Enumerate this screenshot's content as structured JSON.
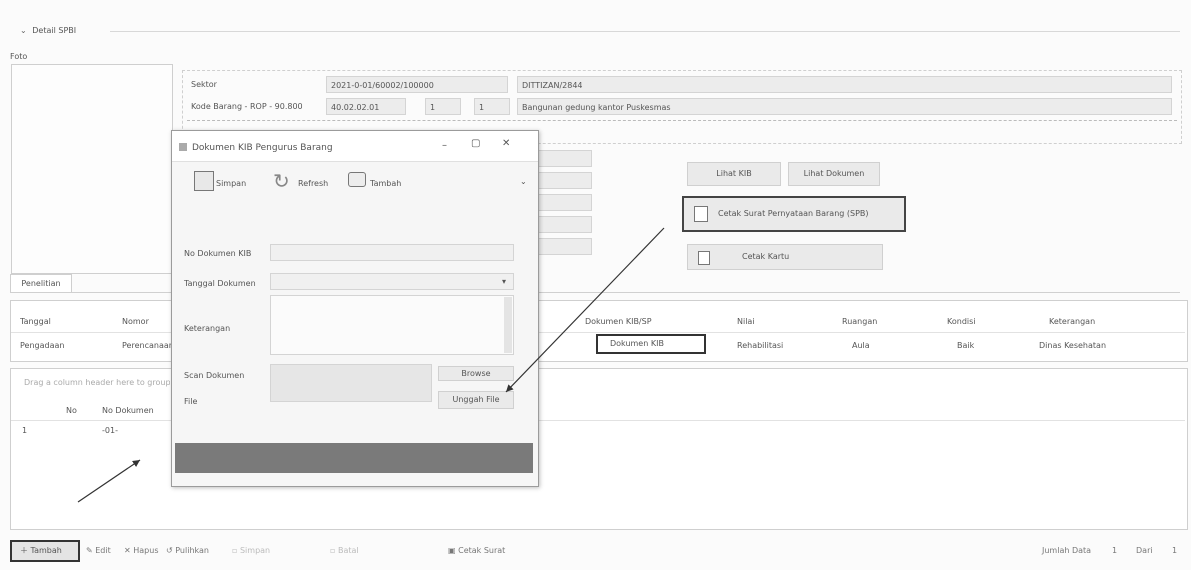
{
  "detail_header": {
    "toggle": "⌄",
    "title": "Detail SPBI",
    "foto_label": "Foto"
  },
  "main_fields": {
    "sektor_label": "Sektor",
    "sektor_code": "2021-0-01/60002/100000",
    "sektor_name": "DITTIZAN/2844",
    "kode_label": "Kode Barang - ROP - 90.800",
    "kode_value": "40.02.02.01",
    "kode_n1": "1",
    "kode_n2": "1",
    "kode_desc": "Bangunan gedung kantor Puskesmas"
  },
  "action_buttons": {
    "lihat_kib": "Lihat KIB",
    "lihat_dokumen": "Lihat Dokumen",
    "cetak_surat": "Cetak Surat Pernyataan Barang (SPB)",
    "cetak_kartu": "Cetak Kartu"
  },
  "tab_label": "Penelitian",
  "grid_headers": [
    "Tanggal",
    "Nomor",
    "Dokumen KIB/SP",
    "Nilai",
    "Ruangan",
    "Kondisi",
    "Keterangan"
  ],
  "grid_row": [
    "Pengadaan",
    "Perencanaan",
    "Dokumen KIB",
    "Rehabilitasi",
    "Aula",
    "Baik",
    "Dinas Kesehatan"
  ],
  "doc_grid": {
    "group_header": "Drag a column header here to group by that column",
    "col_no": "No",
    "col_nomor": "No Dokumen",
    "row_no": "1",
    "row_nomor": "-01-"
  },
  "dialog": {
    "title": "Dokumen KIB Pengurus Barang",
    "toolbar": {
      "simpan": "Simpan",
      "refresh": "Refresh",
      "tambah": "Tambah"
    },
    "labels": {
      "no_dokumen": "No Dokumen KIB",
      "tanggal": "Tanggal Dokumen",
      "keterangan": "Keterangan",
      "scan": "Scan Dokumen",
      "file": "File"
    },
    "tanggal_dropdown": "▾",
    "browse_button": "Browse",
    "upload_button": "Unggah File"
  },
  "bottom_toolbar": {
    "tambah": "Tambah",
    "edit": "Edit",
    "hapus": "Hapus",
    "pulihkan": "Pulihkan",
    "simpan": "Simpan",
    "batal": "Batal",
    "cetak": "Cetak Surat",
    "jumlah_label": "Jumlah Data",
    "jumlah_value": "1",
    "dari_label": "Dari",
    "dari_value": "1"
  }
}
